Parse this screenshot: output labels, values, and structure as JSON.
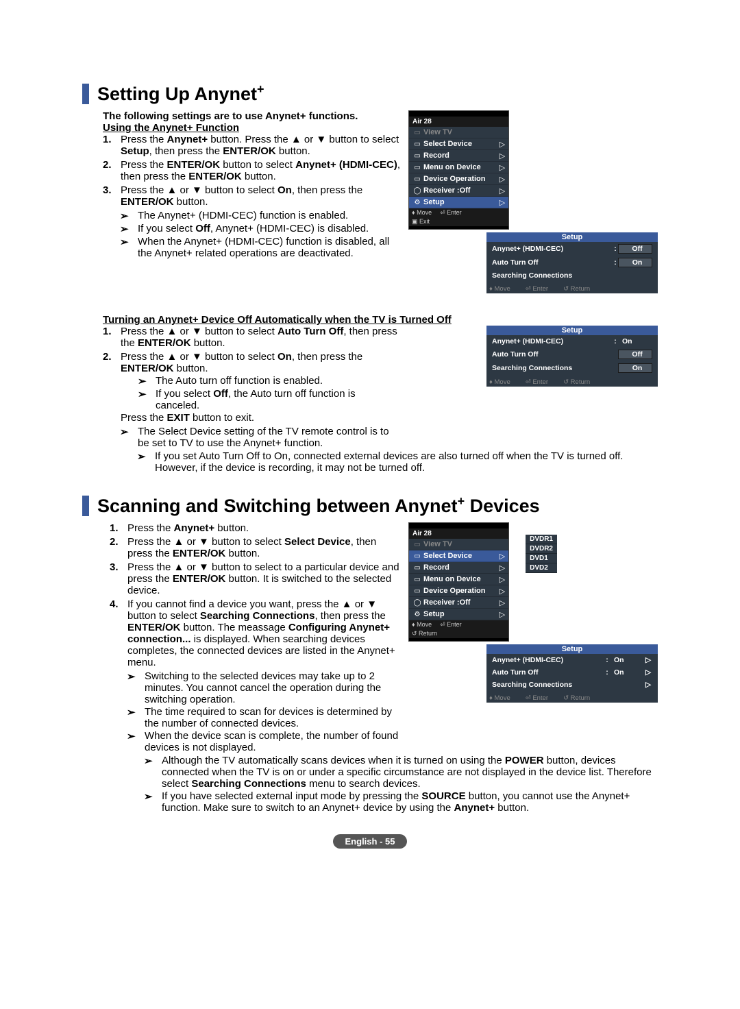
{
  "section1": {
    "title_pre": "Setting Up Anynet",
    "title_sup": "+",
    "intro": "The following settings are to use Anynet+ functions.",
    "sub_a_title": "Using the Anynet+ Function",
    "sub_a_steps": [
      {
        "num": "1.",
        "txt1": "Press the ",
        "b1": "Anynet+",
        "txt2": " button.\nPress the ▲ or ▼ button to select ",
        "b2": "Setup",
        "txt3": ", then press the ",
        "b3": "ENTER/OK",
        "txt4": " button."
      },
      {
        "num": "2.",
        "txt1": "Press the ",
        "b1": "ENTER/OK",
        "txt2": " button to select ",
        "b2": "Anynet+ (HDMI-CEC)",
        "txt3": ", then press the ",
        "b3": "ENTER/OK",
        "txt4": " button."
      },
      {
        "num": "3.",
        "txt1": "Press the ▲ or ▼ button to select ",
        "b1": "On",
        "txt2": ", then press the ",
        "b2": "ENTER/OK",
        "txt3": " button."
      }
    ],
    "sub_a_notes": [
      "The Anynet+ (HDMI-CEC) function is enabled.",
      {
        "pre": "If you select ",
        "b": "Off",
        "post": ", Anynet+ (HDMI-CEC) is disabled."
      },
      "When the Anynet+ (HDMI-CEC) function is disabled, all the Anynet+ related operations are deactivated."
    ],
    "sub_b_title": "Turning an Anynet+ Device Off Automatically when the TV is Turned Off",
    "sub_b_steps": {
      "s1": {
        "num": "1.",
        "txt1": "Press the ▲ or ▼ button to select ",
        "b1": "Auto Turn Off",
        "txt2": ", then press the ",
        "b2": "ENTER/OK",
        "txt3": " button."
      },
      "s2": {
        "num": "2.",
        "txt1": "Press the ▲ or ▼ button to select ",
        "b1": "On",
        "txt2": ", then press the ",
        "b2": "ENTER/OK",
        "txt3": " button."
      }
    },
    "sub_b_subnotes": [
      "The Auto turn off function is enabled.",
      {
        "pre": "If you select ",
        "b": "Off",
        "post": ", the Auto turn off function is canceled."
      }
    ],
    "sub_b_exit": {
      "pre": "Press the ",
      "b": "EXIT",
      "post": " button to exit."
    },
    "sub_b_final_notes": [
      "The Select Device setting of the TV remote control is to be set to TV to use the Anynet+ function.",
      "If you set Auto Turn Off to On, connected external devices are also turned off when the TV is turned off. However, if the device is recording, it may not be turned off."
    ]
  },
  "section2": {
    "title_pre": "Scanning and Switching between Anynet",
    "title_sup": "+",
    "title_post": " Devices",
    "steps": {
      "s1": {
        "num": "1.",
        "txt1": "Press the ",
        "b1": "Anynet+",
        "txt2": " button."
      },
      "s2": {
        "num": "2.",
        "txt1": "Press the ▲ or ▼ button to select ",
        "b1": "Select Device",
        "txt2": ", then press the ",
        "b2": "ENTER/OK",
        "txt3": " button."
      },
      "s3": {
        "num": "3.",
        "txt1": "Press the ▲ or ▼ button to select to a particular device and press the ",
        "b1": "ENTER/OK",
        "txt2": " button.\nIt is switched to the selected device."
      },
      "s4": {
        "num": "4.",
        "txt1": "If you cannot find a device you want, press the ▲ or ▼ button to select ",
        "b1": "Searching Connections",
        "txt2": ", then press the ",
        "b2": "ENTER/OK",
        "txt3": " button.\nThe meassage ",
        "b3": "Configuring Anynet+ connection...",
        "txt4": " is displayed. When searching devices completes, the connected devices are listed in the Anynet+ menu."
      }
    },
    "notes": [
      "Switching to the selected devices may take up to 2 minutes. You cannot cancel the operation during the switching operation.",
      "The time required to scan for devices is determined by the number of connected devices.",
      "When the device scan is complete, the number of found devices is not displayed.",
      {
        "pre": "Although the TV automatically scans devices when it is turned on using the ",
        "b1": "POWER",
        "mid1": " button, devices connected when the TV is on or under a specific circumstance are not displayed in the device list. Therefore select ",
        "b2": "Searching Connections",
        "post": " menu to search devices."
      },
      {
        "pre": "If you have selected external input mode by pressing the ",
        "b1": "SOURCE",
        "mid1": " button, you cannot use the Anynet+ function. Make sure to switch to an Anynet+ device by using the ",
        "b2": "Anynet+",
        "post": " button."
      }
    ]
  },
  "osd1": {
    "header": "Air 28",
    "items": [
      {
        "label": "View TV",
        "dim": true,
        "arrow": ""
      },
      {
        "label": "Select Device",
        "arrow": "▷"
      },
      {
        "label": "Record",
        "arrow": "▷"
      },
      {
        "label": "Menu on Device",
        "arrow": "▷"
      },
      {
        "label": "Device Operation",
        "arrow": "▷"
      },
      {
        "label": "Receiver    :Off",
        "arrow": "▷"
      },
      {
        "label": "Setup",
        "sel": true,
        "arrow": "▷"
      }
    ],
    "footer": {
      "move": "Move",
      "enter": "Enter",
      "exit": "Exit"
    }
  },
  "osd2": {
    "title": "Setup",
    "rows": [
      {
        "label": "Anynet+ (HDMI-CEC)",
        "col": ":",
        "val": "Off",
        "boxed": true
      },
      {
        "label": "Auto Turn Off",
        "col": ":",
        "val": "On",
        "boxed": true
      },
      {
        "label": "Searching Connections"
      }
    ],
    "footer": {
      "move": "Move",
      "enter": "Enter",
      "ret": "Return"
    }
  },
  "osd3": {
    "title": "Setup",
    "rows": [
      {
        "label": "Anynet+ (HDMI-CEC)",
        "col": ":",
        "val": "On"
      },
      {
        "label": "Auto Turn Off",
        "val": "Off",
        "boxed": true
      },
      {
        "label": "Searching Connections",
        "val": "On",
        "boxed": true
      }
    ],
    "footer": {
      "move": "Move",
      "enter": "Enter",
      "ret": "Return"
    }
  },
  "osd4": {
    "header": "Air 28",
    "items": [
      {
        "label": "View TV",
        "dim": true
      },
      {
        "label": "Select Device",
        "sel": true,
        "arrow": "▷"
      },
      {
        "label": "Record",
        "arrow": "▷"
      },
      {
        "label": "Menu on Device",
        "arrow": "▷"
      },
      {
        "label": "Device Operation",
        "arrow": "▷"
      },
      {
        "label": "Receiver    :Off",
        "arrow": "▷"
      },
      {
        "label": "Setup",
        "arrow": "▷"
      }
    ],
    "popup": [
      "DVDR1",
      "DVDR2",
      "DVD1",
      "DVD2"
    ],
    "footer": {
      "move": "Move",
      "enter": "Enter",
      "ret": "Return"
    }
  },
  "osd5": {
    "title": "Setup",
    "rows": [
      {
        "label": "Anynet+ (HDMI-CEC)",
        "col": ":",
        "val": "On",
        "arrow": "▷"
      },
      {
        "label": "Auto Turn Off",
        "col": ":",
        "val": "On",
        "arrow": "▷"
      },
      {
        "label": "Searching Connections",
        "arrow": "▷"
      }
    ],
    "footer": {
      "move": "Move",
      "enter": "Enter",
      "ret": "Return"
    }
  },
  "glyphs": {
    "note_sym": "➢",
    "updown": "♦",
    "enter_icon": "⏎",
    "return_icon": "↺"
  },
  "page_footer": "English - 55"
}
